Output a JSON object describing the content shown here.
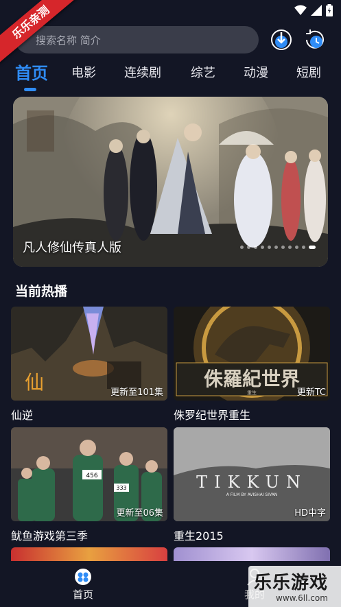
{
  "ribbon": {
    "text": "乐乐亲测"
  },
  "search": {
    "placeholder": "搜索名称 简介"
  },
  "header": {
    "icons": [
      "download-icon",
      "history-icon"
    ]
  },
  "tabs": [
    {
      "label": "首页",
      "active": true
    },
    {
      "label": "电影"
    },
    {
      "label": "连续剧"
    },
    {
      "label": "综艺"
    },
    {
      "label": "动漫"
    },
    {
      "label": "短剧"
    }
  ],
  "banner": {
    "title": "凡人修仙传真人版",
    "dot_count": 11,
    "active_dot": 10
  },
  "section": {
    "title": "当前热播"
  },
  "cards": [
    {
      "title": "仙逆",
      "badge": "更新至101集"
    },
    {
      "title": "侏罗纪世界重生",
      "badge": "更新TC"
    },
    {
      "title": "鱿鱼游戏第三季",
      "badge": "更新至06集"
    },
    {
      "title": "重生2015",
      "badge": "HD中字"
    }
  ],
  "poster_text": {
    "jurassic": "侏羅紀世界",
    "jurassic_sub": "重生",
    "tikkun": "TIKKUN",
    "tikkun_sub": "A FILM BY AVISHAI SIVAN",
    "squid_456": "456",
    "squid_333": "333"
  },
  "bottom_nav": [
    {
      "label": "首页",
      "icon": "home-icon"
    },
    {
      "label": "我的",
      "icon": "profile-icon"
    }
  ],
  "watermark": {
    "text": "乐乐游戏",
    "url": "www.6ll.com"
  },
  "colors": {
    "accent": "#2f8cf6",
    "background": "#131625",
    "ribbon": "#d6262b"
  }
}
